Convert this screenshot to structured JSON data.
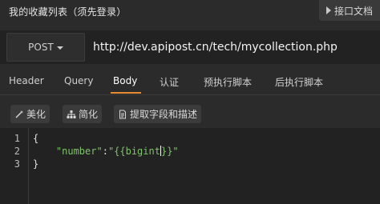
{
  "header": {
    "title": "我的收藏列表（须先登录）",
    "doc_button": "接口文档"
  },
  "request": {
    "method": "POST",
    "url": "http://dev.apipost.cn/tech/mycollection.php"
  },
  "tabs": [
    {
      "label": "Header"
    },
    {
      "label": "Query"
    },
    {
      "label": "Body",
      "active": true
    },
    {
      "label": "认证"
    },
    {
      "label": "预执行脚本"
    },
    {
      "label": "后执行脚本"
    }
  ],
  "toolbar": {
    "beautify": "美化",
    "simplify": "简化",
    "extract": "提取字段和描述"
  },
  "editor": {
    "line_numbers": [
      "1",
      "2",
      "3"
    ],
    "line1": "{",
    "line2_key": "\"number\"",
    "line2_colon": ":",
    "line2_value_a": "\"{{bigint",
    "line2_value_b": "}}\"",
    "line3": "}"
  },
  "colors": {
    "accent": "#e88a30",
    "string": "#7fc36b",
    "background": "#2b2b2b"
  }
}
